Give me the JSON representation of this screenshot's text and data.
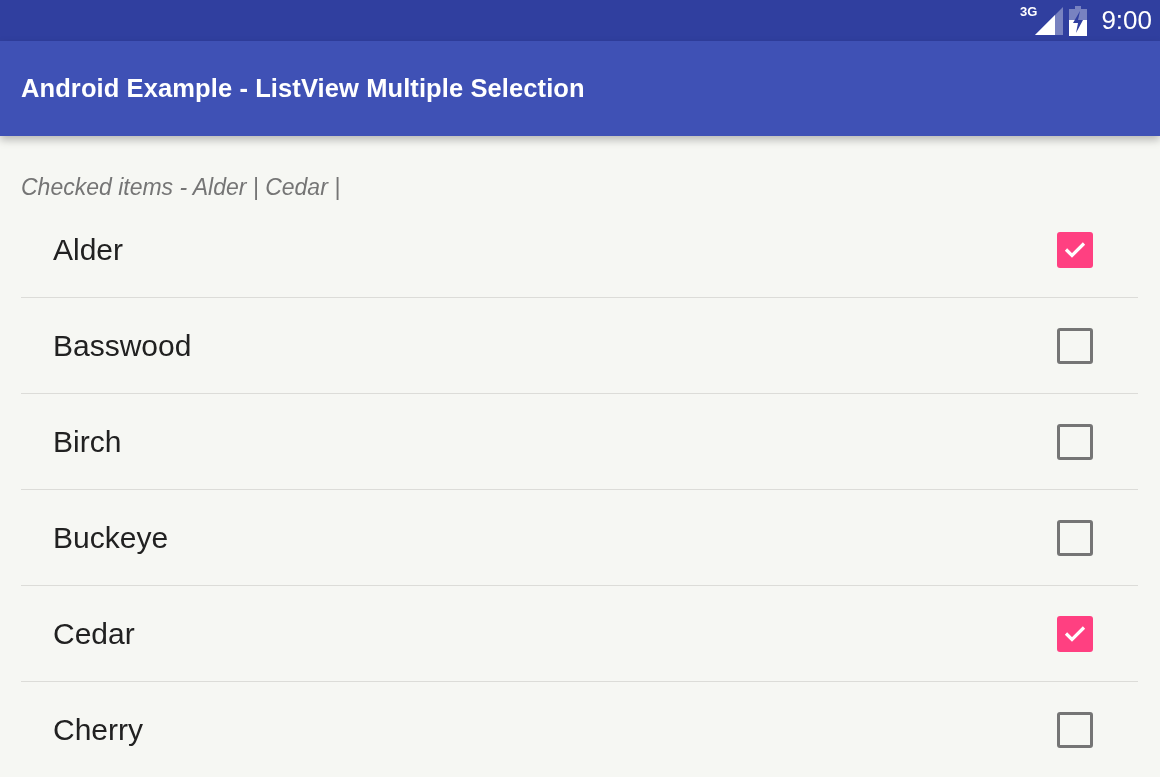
{
  "status_bar": {
    "network": "3G",
    "time": "9:00"
  },
  "app_bar": {
    "title": "Android Example - ListView Multiple Selection"
  },
  "checked_summary": "Checked items - Alder | Cedar |",
  "items": [
    {
      "label": "Alder",
      "checked": true
    },
    {
      "label": "Basswood",
      "checked": false
    },
    {
      "label": "Birch",
      "checked": false
    },
    {
      "label": "Buckeye",
      "checked": false
    },
    {
      "label": "Cedar",
      "checked": true
    },
    {
      "label": "Cherry",
      "checked": false
    }
  ]
}
